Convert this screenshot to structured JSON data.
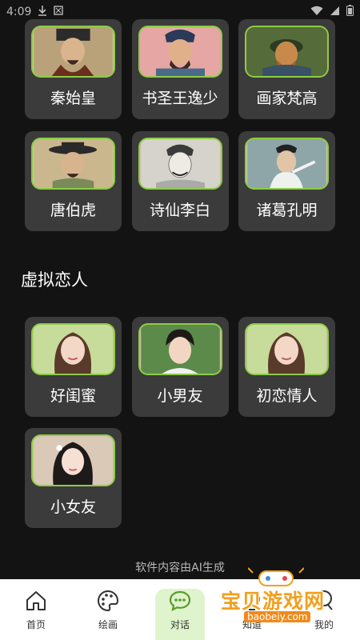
{
  "status_bar": {
    "time": "4:09"
  },
  "historical": {
    "row1": [
      {
        "label": "秦始皇"
      },
      {
        "label": "书圣王逸少"
      },
      {
        "label": "画家梵高"
      }
    ],
    "row2": [
      {
        "label": "唐伯虎"
      },
      {
        "label": "诗仙李白"
      },
      {
        "label": "诸葛孔明"
      }
    ]
  },
  "virtual_lover": {
    "title": "虚拟恋人",
    "row1": [
      {
        "label": "好闺蜜"
      },
      {
        "label": "小男友"
      },
      {
        "label": "初恋情人"
      }
    ],
    "row2": [
      {
        "label": "小女友"
      }
    ]
  },
  "footer_note": "软件内容由AI生成",
  "bottom_nav": {
    "items": [
      {
        "label": "首页",
        "icon": "home-icon"
      },
      {
        "label": "绘画",
        "icon": "palette-icon"
      },
      {
        "label": "对话",
        "icon": "chat-icon"
      },
      {
        "label": "知道",
        "icon": "knowledge-icon"
      },
      {
        "label": "我的",
        "icon": "profile-icon"
      }
    ],
    "active_index": 2
  },
  "watermark": {
    "text": "宝贝游戏网",
    "url": "baobeiy.com"
  },
  "colors": {
    "accent": "#8ccc45",
    "card": "#3b3b3b",
    "background": "#131313",
    "nav_active": "#dff3cc"
  }
}
